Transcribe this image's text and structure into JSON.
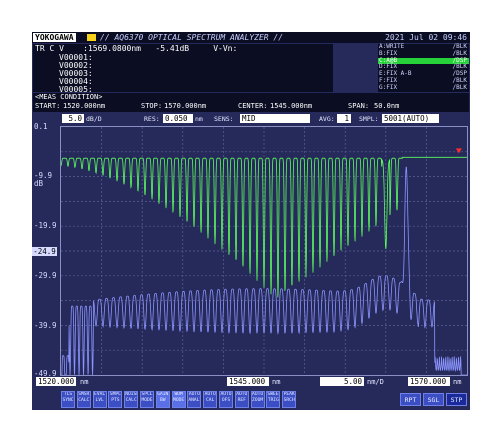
{
  "header": {
    "brand": "YOKOGAWA",
    "model": "// AQ6370 OPTICAL SPECTRUM ANALYZER //",
    "datetime": "2021 Jul 02 09:46"
  },
  "marker": {
    "line1": "TR C V    :1569.0800nm   -5.41dB     V-Vn:",
    "lines": [
      "V00001:",
      "V00002:",
      "V00003:",
      "V00004:",
      "V00005:"
    ]
  },
  "traces": [
    {
      "name": "A:WRITE",
      "state": "/BLK"
    },
    {
      "name": "B:FIX",
      "state": "/BLK"
    },
    {
      "name": "C:A@B",
      "state": "/DSP"
    },
    {
      "name": "D:FIX",
      "state": "/BLK"
    },
    {
      "name": "E:FIX A-B",
      "state": "/DSP"
    },
    {
      "name": "F:FIX",
      "state": "/BLK"
    },
    {
      "name": "G:FIX",
      "state": "/BLK"
    }
  ],
  "meas": {
    "title": "<MEAS CONDITION>",
    "start_label": "START:",
    "start": "1520.000nm",
    "stop_label": "STOP:",
    "stop": "1570.000nm",
    "center_label": "CENTER:",
    "center": "1545.000nm",
    "span_label": "SPAN:",
    "span": "50.0nm"
  },
  "settings": {
    "scale": "5.0",
    "scale_unit": "dB/D",
    "res_label": "RES:",
    "res": "0.050",
    "res_unit": "nm",
    "sens_label": "SENS:",
    "sens": "MID",
    "avg_label": "AVG:",
    "avg": "1",
    "smpl_label": "SMPL:",
    "smpl": "5001(AUTO)"
  },
  "y_axis": {
    "ticks": [
      "0.1",
      "-9.9",
      "dB",
      "-19.9",
      "-29.9",
      "-39.9",
      "-49.9"
    ],
    "ref": "-24.9"
  },
  "x_axis": {
    "start": "1520.000",
    "center": "1545.000",
    "scale": "5.00",
    "scale_unit": "nm/D",
    "stop": "1570.000",
    "unit": "nm"
  },
  "softkeys": [
    "TLS SYNC",
    "SMSR CALC",
    "EVAL LVL",
    "SMPL PTS",
    "NOISE CALC",
    "SPCL MODE",
    "GAIN BW",
    "WDM MODE",
    "AUTO ANALY",
    "AUTO CAL",
    "AUTO OFS",
    "AUTO REF",
    "AUTO ZOOM",
    "SWEEP TRIG",
    "PEAK SRCH"
  ],
  "softkeys_right": [
    "RPT",
    "SGL",
    "STP"
  ],
  "colors": {
    "screen_bg": "#262a5a",
    "trace_green": "#5cff5c",
    "trace_blue": "#8c95ff",
    "marker_red": "#ff2b2b"
  }
}
